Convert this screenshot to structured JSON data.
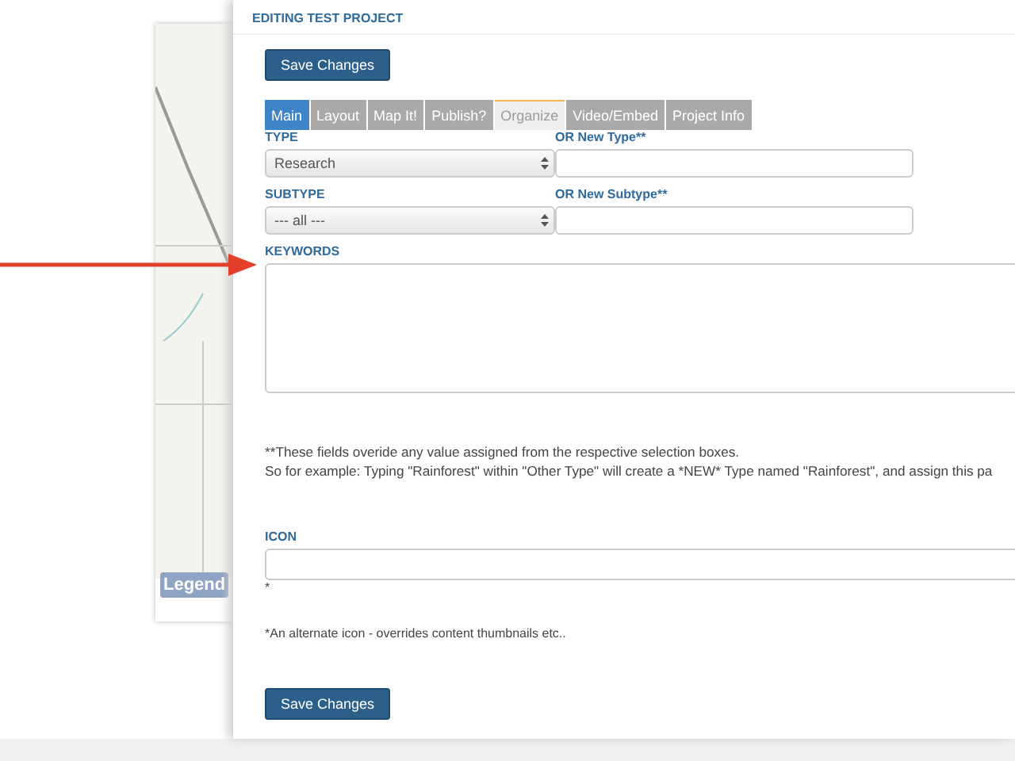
{
  "editor": {
    "title": "EDITING TEST PROJECT",
    "save_top": "Save Changes",
    "tabs": [
      {
        "label": "Main",
        "selected": true,
        "disabled": false
      },
      {
        "label": "Layout",
        "selected": false,
        "disabled": false
      },
      {
        "label": "Map It!",
        "selected": false,
        "disabled": false
      },
      {
        "label": "Publish?",
        "selected": false,
        "disabled": false
      },
      {
        "label": "Organize",
        "selected": false,
        "disabled": true
      },
      {
        "label": "Video/Embed",
        "selected": false,
        "disabled": false
      },
      {
        "label": "Project Info",
        "selected": false,
        "disabled": false
      }
    ],
    "type": {
      "label": "TYPE",
      "value": "Research"
    },
    "new_type": {
      "label": "OR New Type**"
    },
    "subtype": {
      "label": "SUBTYPE",
      "value": "--- all ---"
    },
    "new_subtype": {
      "label": "OR New Subtype**"
    },
    "keywords": {
      "label": "KEYWORDS"
    },
    "note": [
      "**These fields overide any value assigned from the respective selection boxes.",
      "So for example: Typing \"Rainforest\" within \"Other Type\" will create a *NEW* Type named \"Rainforest\", and assign this pa"
    ],
    "icon": {
      "label": "ICON",
      "marker": "*",
      "hint": "*An alternate icon - overrides content thumbnails etc.."
    },
    "save_bottom": "Save Changes"
  },
  "map": {
    "legend": "Legend"
  }
}
